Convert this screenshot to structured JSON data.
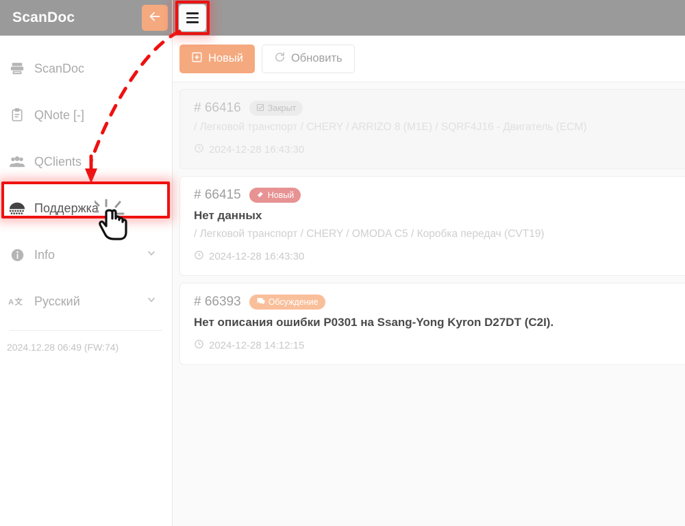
{
  "sidebar": {
    "brand": "ScanDoc",
    "items": [
      {
        "label": "ScanDoc",
        "icon": "scanner-icon",
        "active": false,
        "chevron": false
      },
      {
        "label": "QNote [-]",
        "icon": "clipboard-icon",
        "active": false,
        "chevron": false
      },
      {
        "label": "QClients",
        "icon": "users-icon",
        "active": false,
        "chevron": false
      },
      {
        "label": "Поддержка",
        "icon": "support-icon",
        "active": true,
        "chevron": false
      },
      {
        "label": "Info",
        "icon": "info-icon",
        "active": false,
        "chevron": true
      },
      {
        "label": "Русский",
        "icon": "language-icon",
        "active": false,
        "chevron": true
      }
    ],
    "footer": "2024.12.28 06:49 (FW:74)"
  },
  "topbar": {
    "back_icon": "arrow-left-icon",
    "menu_icon": "hamburger-icon"
  },
  "toolbar": {
    "new_label": "Новый",
    "new_icon": "plus-square-icon",
    "refresh_label": "Обновить",
    "refresh_icon": "refresh-icon"
  },
  "tickets": [
    {
      "id": "# 66416",
      "badge": "Закрыт",
      "badge_type": "closed",
      "badge_icon": "checkbox-icon",
      "title": "",
      "path": "/ Легковой транспорт / CHERY / ARRIZO 8 (M1E) / SQRF4J16 - Двигатель (ECM)",
      "date": "2024-12-28 16:43:30",
      "date_icon": "clock-icon",
      "read": true
    },
    {
      "id": "# 66415",
      "badge": "Новый",
      "badge_type": "new",
      "badge_icon": "tag-icon",
      "title": "Нет данных",
      "path": "/ Легковой транспорт / CHERY / OMODA C5 / Коробка передач (CVT19)",
      "date": "2024-12-28 16:43:30",
      "date_icon": "clock-icon",
      "read": false
    },
    {
      "id": "# 66393",
      "badge": "Обсуждение",
      "badge_type": "discussion",
      "badge_icon": "comment-icon",
      "title": "Нет описания ошибки P0301 на Ssang-Yong Kyron D27DT (C2I).",
      "path": "",
      "date": "2024-12-28 14:12:15",
      "date_icon": "clock-icon",
      "read": false
    }
  ],
  "annotations": {
    "highlight_color": "#ee1111",
    "arrow_from": "hamburger-button",
    "arrow_to": "sidebar-item-support",
    "cursor": "hand-pointer-cursor"
  },
  "colors": {
    "header_bg": "#9a9a9a",
    "accent": "#f5a97f",
    "badge_new": "#e79293",
    "badge_discussion": "#f9bf9b",
    "badge_closed": "#ececec"
  }
}
